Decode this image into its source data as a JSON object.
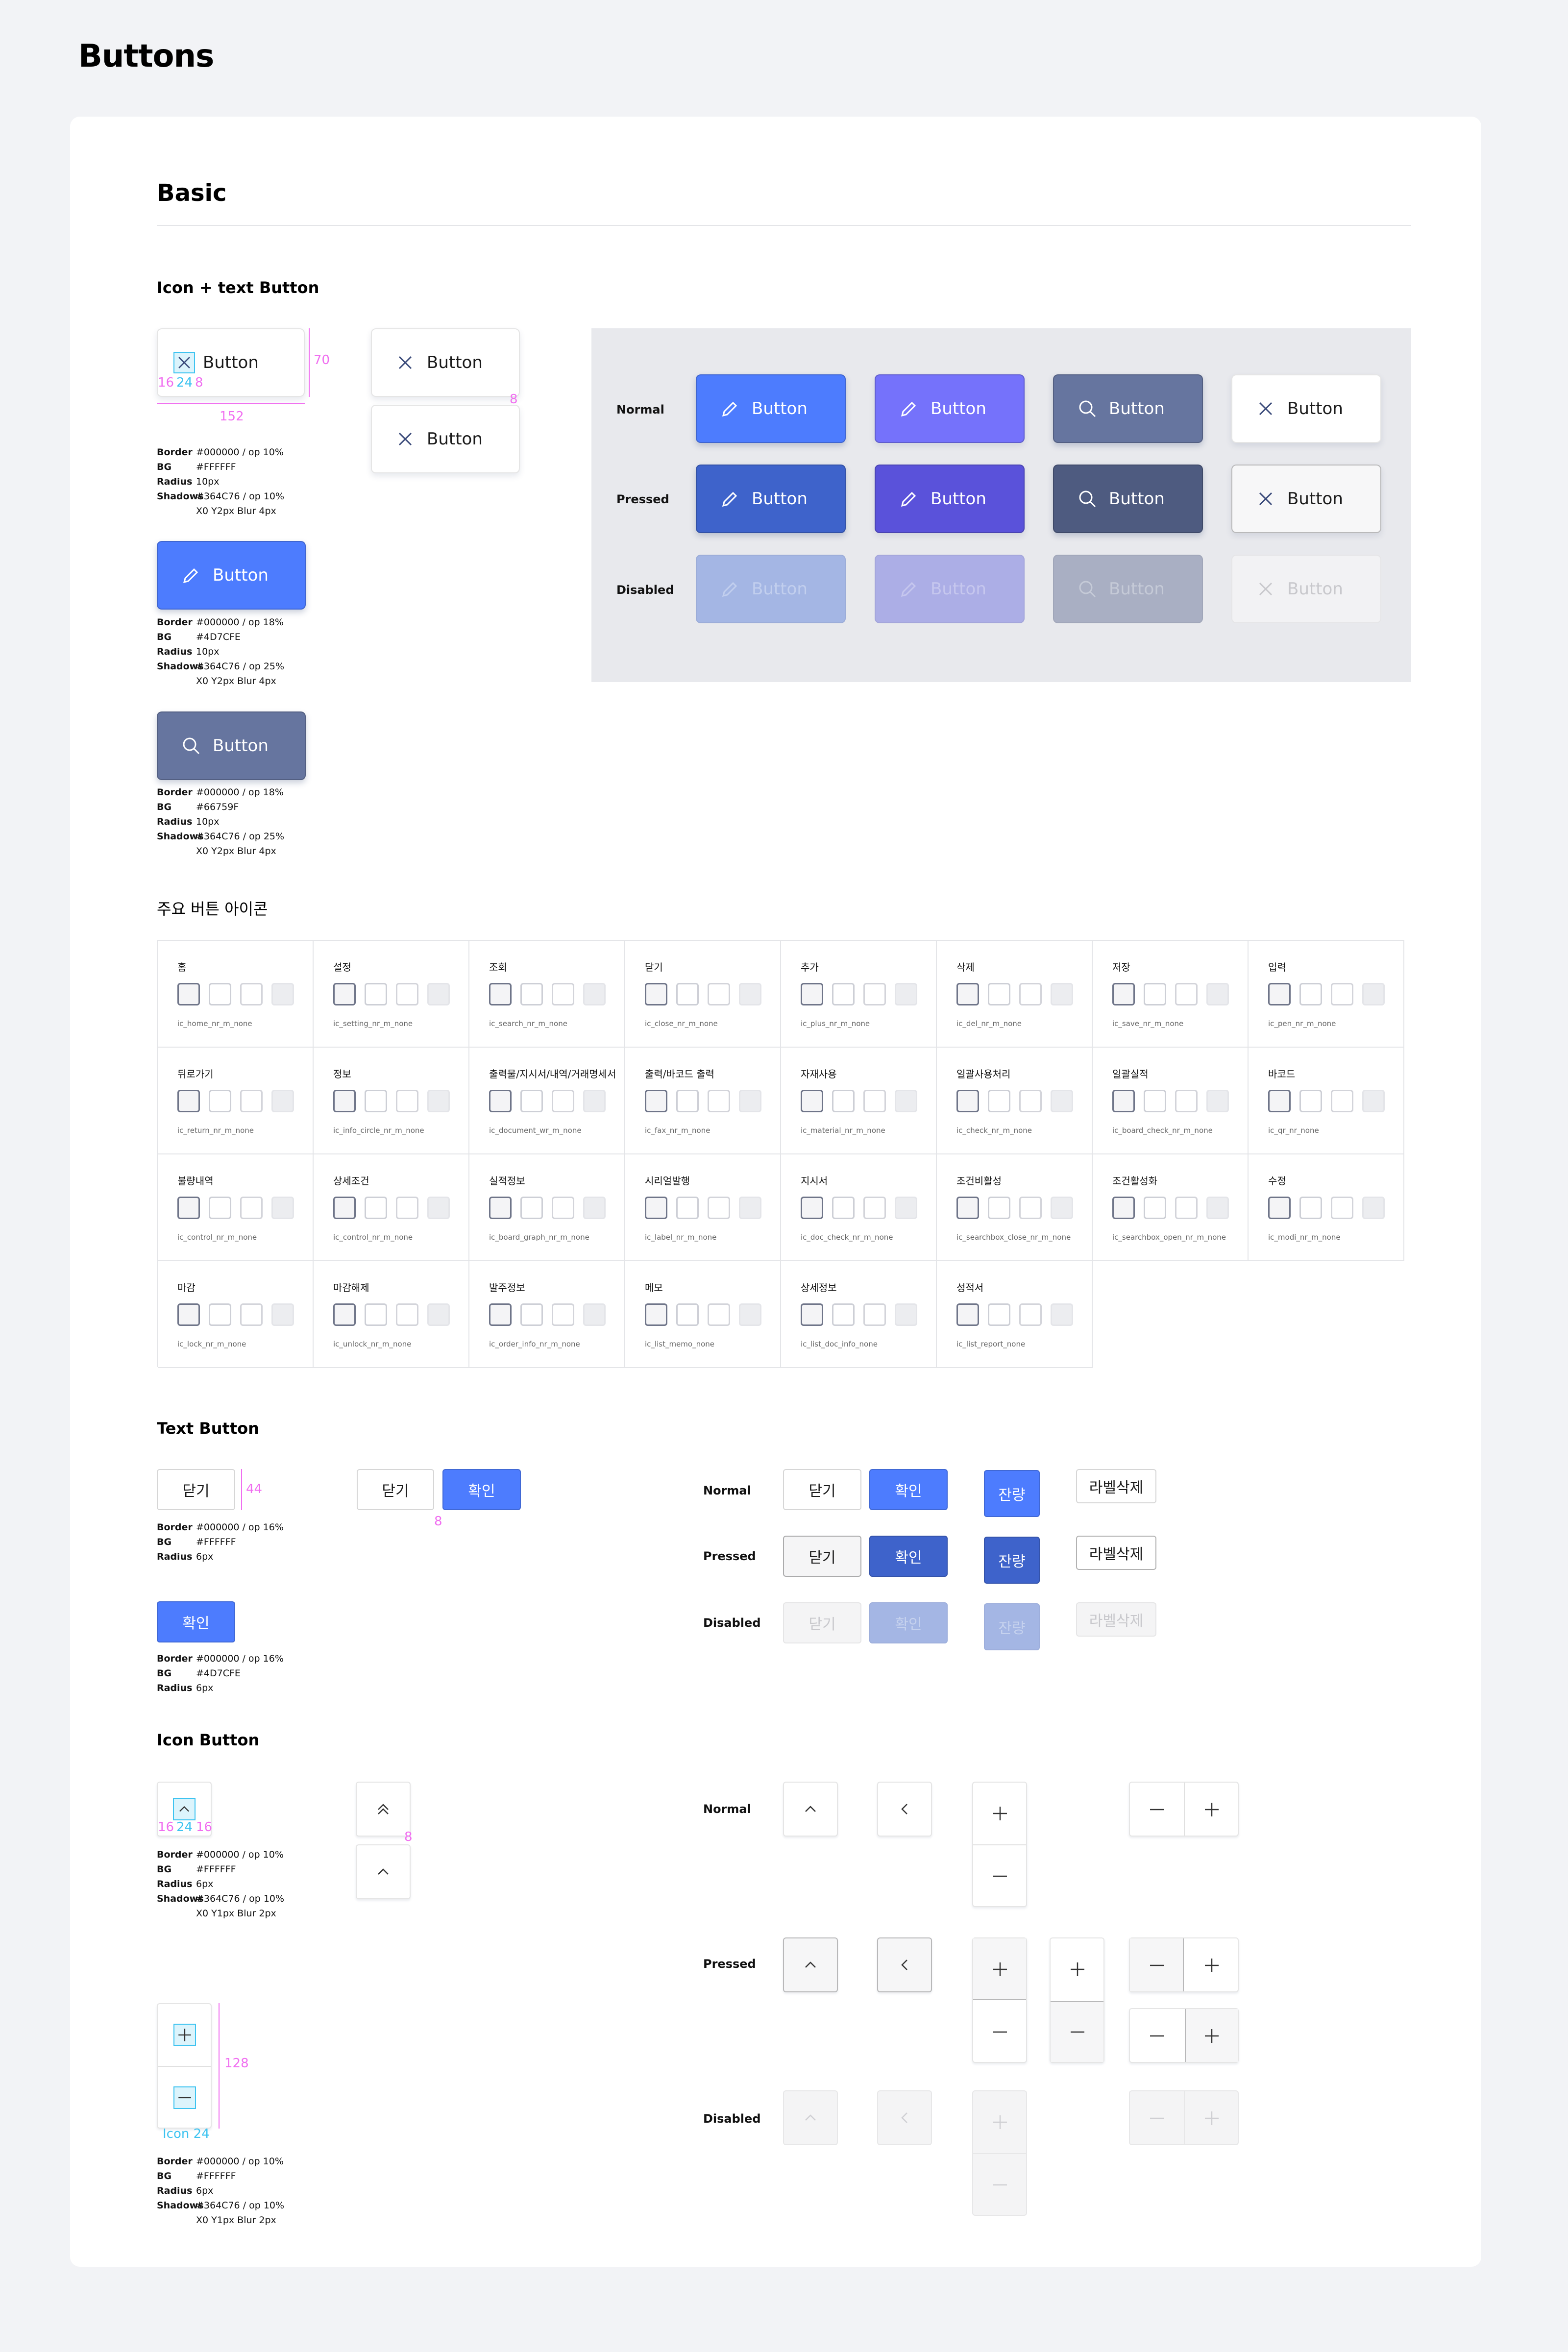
{
  "page": {
    "title": "Buttons"
  },
  "basic": {
    "title": "Basic"
  },
  "icon_text": {
    "title": "Icon + text Button",
    "button_label": "Button",
    "dims": {
      "w": "152",
      "h": "70",
      "gap": "8",
      "left": "16",
      "icon": "24",
      "mid": "8"
    },
    "specs": [
      {
        "border": "#000000 / op 10%",
        "bg": "#FFFFFF",
        "radius": "10px",
        "shadows": "#364C76 / op 10%",
        "shadow2": "X0  Y2px  Blur 4px"
      },
      {
        "border": "#000000 / op 18%",
        "bg": "#4D7CFE",
        "radius": "10px",
        "shadows": "#364C76 / op 25%",
        "shadow2": "X0  Y2px  Blur 4px"
      },
      {
        "border": "#000000 / op 18%",
        "bg": "#66759F",
        "radius": "10px",
        "shadows": "#364C76 / op 25%",
        "shadow2": "X0  Y2px  Blur 4px"
      }
    ],
    "spec_labels": {
      "border": "Border",
      "bg": "BG",
      "radius": "Radius",
      "shadows": "Shadows"
    },
    "states": [
      "Normal",
      "Pressed",
      "Disabled"
    ]
  },
  "icons_section": {
    "title": "주요 버튼 아이콘",
    "items": [
      {
        "title": "홈",
        "code": "ic_home_nr_m_none",
        "icon": "home-icon"
      },
      {
        "title": "설정",
        "code": "ic_setting_nr_m_none",
        "icon": "gear-icon"
      },
      {
        "title": "조회",
        "code": "ic_search_nr_m_none",
        "icon": "search-icon"
      },
      {
        "title": "닫기",
        "code": "ic_close_nr_m_none",
        "icon": "close-icon"
      },
      {
        "title": "추가",
        "code": "ic_plus_nr_m_none",
        "icon": "plus-icon"
      },
      {
        "title": "삭제",
        "code": "ic_del_nr_m_none",
        "icon": "trash-icon"
      },
      {
        "title": "저장",
        "code": "ic_save_nr_m_none",
        "icon": "save-icon"
      },
      {
        "title": "입력",
        "code": "ic_pen_nr_m_none",
        "icon": "pen-icon"
      },
      {
        "title": "뒤로가기",
        "code": "ic_return_nr_m_none",
        "icon": "return-icon"
      },
      {
        "title": "정보",
        "code": "ic_info_circle_nr_m_none",
        "icon": "info-icon"
      },
      {
        "title": "출력물/지시서/내역/거래명세서",
        "code": "ic_document_wr_m_none",
        "icon": "document-icon"
      },
      {
        "title": "출력/바코드 출력",
        "code": "ic_fax_nr_m_none",
        "icon": "printer-icon"
      },
      {
        "title": "자재사용",
        "code": "ic_material_nr_m_none",
        "icon": "material-icon"
      },
      {
        "title": "일괄사용처리",
        "code": "ic_check_nr_m_none",
        "icon": "check-icon"
      },
      {
        "title": "일괄실적",
        "code": "ic_board_check_nr_m_none",
        "icon": "board-check-icon"
      },
      {
        "title": "바코드",
        "code": "ic_qr_nr_none",
        "icon": "qr-icon"
      },
      {
        "title": "불량내역",
        "code": "ic_control_nr_m_none",
        "icon": "sad-face-icon"
      },
      {
        "title": "상세조건",
        "code": "ic_control_nr_m_none",
        "icon": "sliders-icon"
      },
      {
        "title": "실적정보",
        "code": "ic_board_graph_nr_m_none",
        "icon": "board-graph-icon"
      },
      {
        "title": "시리얼발행",
        "code": "ic_label_nr_m_none",
        "icon": "label-icon"
      },
      {
        "title": "지시서",
        "code": "ic_doc_check_nr_m_none",
        "icon": "doc-check-icon"
      },
      {
        "title": "조건비활성",
        "code": "ic_searchbox_close_nr_m_none",
        "icon": "searchbox-close-icon"
      },
      {
        "title": "조건활성화",
        "code": "ic_searchbox_open_nr_m_none",
        "icon": "searchbox-open-icon"
      },
      {
        "title": "수정",
        "code": "ic_modi_nr_m_none",
        "icon": "edit-icon"
      },
      {
        "title": "마감",
        "code": "ic_lock_nr_m_none",
        "icon": "lock-icon"
      },
      {
        "title": "마감해제",
        "code": "ic_unlock_nr_m_none",
        "icon": "unlock-icon"
      },
      {
        "title": "발주정보",
        "code": "ic_order_info_nr_m_none",
        "icon": "order-info-icon"
      },
      {
        "title": "메모",
        "code": "ic_list_memo_none",
        "icon": "memo-icon"
      },
      {
        "title": "상세정보",
        "code": "ic_list_doc_info_none",
        "icon": "doc-info-icon"
      },
      {
        "title": "성적서",
        "code": "ic_list_report_none",
        "icon": "report-icon"
      }
    ]
  },
  "text_button": {
    "title": "Text Button",
    "close": "닫기",
    "confirm": "확인",
    "remaining": "잔량",
    "delete_label": "라벨삭제",
    "dims": {
      "h": "44",
      "gap": "8"
    },
    "specs": [
      {
        "border": "#000000 / op 16%",
        "bg": "#FFFFFF",
        "radius": "6px"
      },
      {
        "border": "#000000 / op 16%",
        "bg": "#4D7CFE",
        "radius": "6px"
      }
    ],
    "states": [
      "Normal",
      "Pressed",
      "Disabled"
    ]
  },
  "icon_button": {
    "title": "Icon Button",
    "dims": {
      "left": "16",
      "icon": "24",
      "right": "16",
      "gap": "8",
      "h": "128",
      "icon_label": "Icon 24"
    },
    "specs": [
      {
        "border": "#000000 / op 10%",
        "bg": "#FFFFFF",
        "radius": "6px",
        "shadows": "#364C76 / op 10%",
        "shadow2": "X0  Y1px  Blur 2px"
      },
      {
        "border": "#000000 / op 10%",
        "bg": "#FFFFFF",
        "radius": "6px",
        "shadows": "#364C76 / op 10%",
        "shadow2": "X0  Y1px  Blur 2px"
      }
    ],
    "states": [
      "Normal",
      "Pressed",
      "Disabled"
    ]
  },
  "colors": {
    "blue": "#4D7CFE",
    "violet": "#7572FB",
    "slate": "#66759F",
    "pink": "#F06EF0",
    "cyan": "#3DC3F0"
  }
}
